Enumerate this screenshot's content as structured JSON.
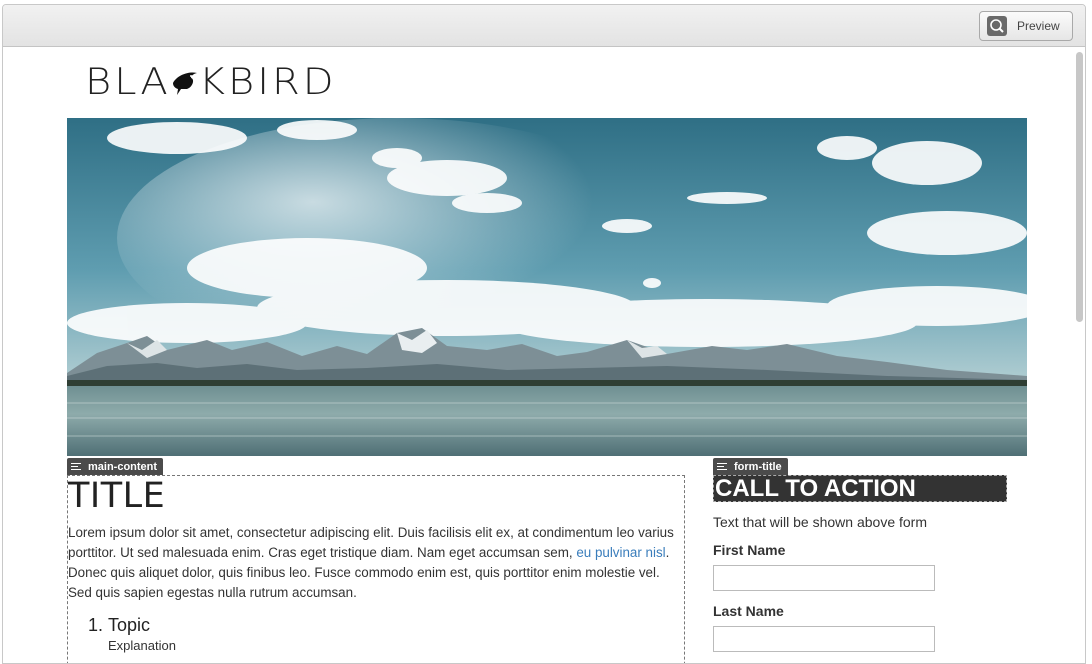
{
  "toolbar": {
    "preview_label": "Preview",
    "preview_icon": "magnifier-icon"
  },
  "site": {
    "logo_text_left": "BLA",
    "logo_text_right": "KBIRD",
    "logo_icon": "blackbird-bird-icon"
  },
  "hero": {
    "description_icon": "mountain-lake-landscape"
  },
  "main": {
    "tag_label": "main-content",
    "title": "TITLE",
    "paragraph_part1": "Lorem ipsum dolor sit amet, consectetur adipiscing elit. Duis facilisis elit ex, at condimentum leo varius porttitor. Ut sed malesuada enim. Cras eget tristique diam. Nam eget accumsan sem, ",
    "paragraph_link": "eu pulvinar nisl",
    "paragraph_part2": ". Donec quis aliquet dolor, quis finibus leo. Fusce commodo enim est, quis porttitor enim molestie vel. Sed quis sapien egestas nulla rutrum accumsan.",
    "list_item_1": "Topic",
    "list_item_1_expl": "Explanation"
  },
  "form": {
    "tag_label": "form-title",
    "title": "CALL TO ACTION",
    "intro": "Text that will be shown above form",
    "first_name_label": "First Name",
    "last_name_label": "Last Name",
    "first_name_value": "",
    "last_name_value": ""
  },
  "colors": {
    "link": "#3a7dbb",
    "tag_bg": "#4b4b4b",
    "cta_bg": "#333333"
  }
}
